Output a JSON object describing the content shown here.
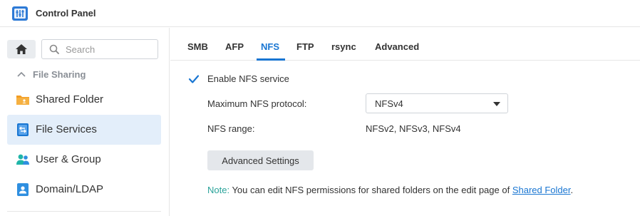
{
  "window": {
    "title": "Control Panel",
    "app_icon": "control-panel-icon"
  },
  "sidebar": {
    "home_icon": "home-icon",
    "search": {
      "placeholder": "Search",
      "value": ""
    },
    "section": {
      "label": "File Sharing",
      "icon": "chevron-up-icon",
      "expanded": true
    },
    "items": [
      {
        "label": "Shared Folder",
        "icon": "shared-folder-icon",
        "active": false
      },
      {
        "label": "File Services",
        "icon": "file-services-icon",
        "active": true
      },
      {
        "label": "User & Group",
        "icon": "user-group-icon",
        "active": false
      },
      {
        "label": "Domain/LDAP",
        "icon": "domain-ldap-icon",
        "active": false
      }
    ]
  },
  "tabs": [
    {
      "label": "SMB",
      "active": false
    },
    {
      "label": "AFP",
      "active": false
    },
    {
      "label": "NFS",
      "active": true
    },
    {
      "label": "FTP",
      "active": false
    },
    {
      "label": "rsync",
      "active": false
    },
    {
      "label": "Advanced",
      "active": false
    }
  ],
  "nfs": {
    "enable_label": "Enable NFS service",
    "enabled": true,
    "max_protocol_label": "Maximum NFS protocol:",
    "max_protocol_value": "NFSv4",
    "range_label": "NFS range:",
    "range_value": "NFSv2, NFSv3, NFSv4",
    "advanced_button": "Advanced Settings",
    "note_prefix": "Note:",
    "note_text": " You can edit NFS permissions for shared folders on the edit page of ",
    "note_link": "Shared Folder",
    "note_suffix": "."
  },
  "colors": {
    "accent": "#1976d2",
    "active_item_bg": "#e3eefa",
    "note_prefix": "#2aa39a",
    "folder_orange": "#f39c21",
    "user_teal": "#1fb5a8"
  }
}
